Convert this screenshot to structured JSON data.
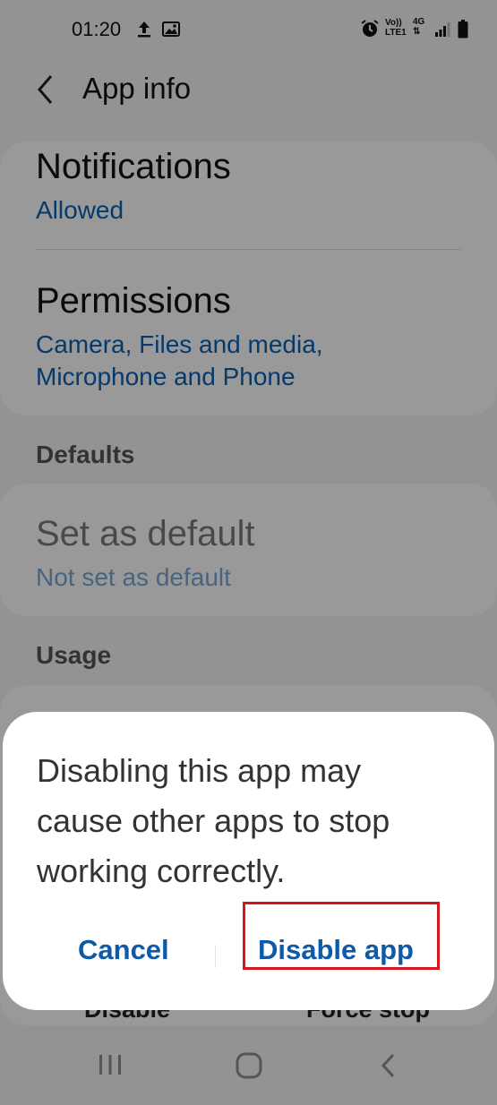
{
  "status_bar": {
    "time": "01:20",
    "volte_line1": "Vo))",
    "volte_line2": "LTE1",
    "network": "4G",
    "icons": [
      "upload-icon",
      "gallery-icon",
      "alarm-icon",
      "signal-icon",
      "battery-icon"
    ]
  },
  "header": {
    "title": "App info",
    "back_icon": "chevron-left-icon"
  },
  "settings": {
    "notifications": {
      "title": "Notifications",
      "value": "Allowed"
    },
    "permissions": {
      "title": "Permissions",
      "value_line1": "Camera, Files and media,",
      "value_line2": "Microphone and Phone"
    },
    "defaults_header": "Defaults",
    "set_as_default": {
      "title": "Set as default",
      "value": "Not set as default"
    },
    "usage_header": "Usage",
    "bottom_actions": {
      "disable": "Disable",
      "force_stop": "Force stop"
    }
  },
  "dialog": {
    "message_line1": "Disabling this app may",
    "message_line2": "cause other apps to stop",
    "message_line3": "working correctly.",
    "cancel_label": "Cancel",
    "confirm_label": "Disable app",
    "highlight_color": "#d7141f"
  },
  "nav_bar": {
    "icons": [
      "recents-icon",
      "home-icon",
      "back-icon"
    ]
  },
  "colors": {
    "accent": "#0a5fb4",
    "dialog_button": "#0f5aa8"
  }
}
